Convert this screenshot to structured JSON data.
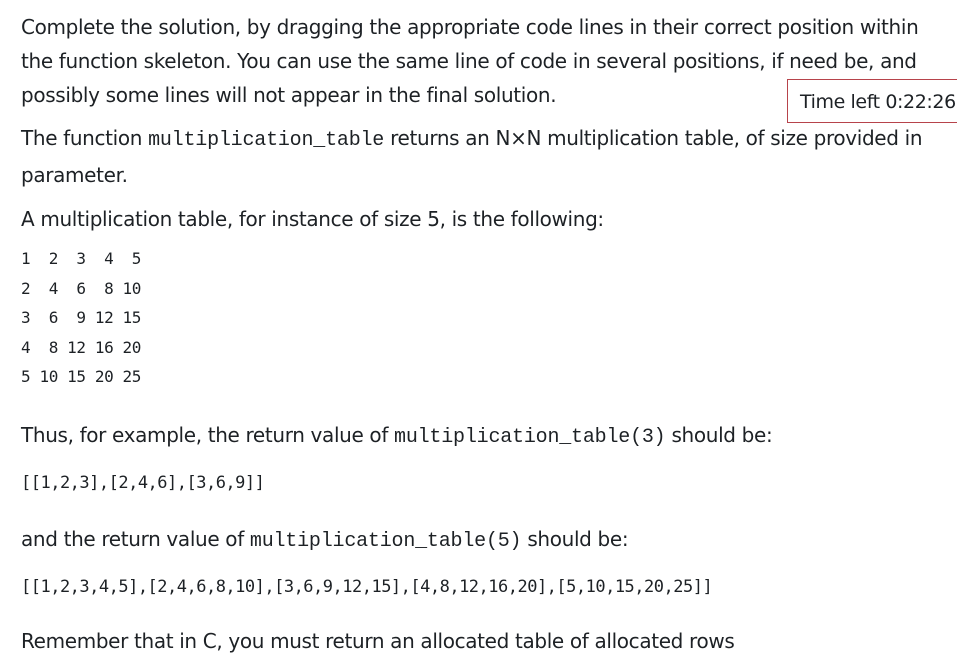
{
  "instructions": "Complete the solution, by dragging the appropriate code lines in their correct position within the function skeleton. You can use the same line of code in several positions, if need be, and possibly some lines will not appear in the final solution.",
  "timer": {
    "text": "Time left 0:22:26"
  },
  "description": {
    "part1": "The function ",
    "function_name": "multiplication_table",
    "part2": " returns an N×N multiplication table, of size provided in parameter."
  },
  "example_intro": "A multiplication table, for instance of size 5, is the following:",
  "table_rows": [
    "1  2  3  4  5",
    "2  4  6  8 10",
    "3  6  9 12 15",
    "4  8 12 16 20",
    "5 10 15 20 25"
  ],
  "example1": {
    "prefix": "Thus, for example, the return value of ",
    "call": "multiplication_table(3)",
    "suffix": " should be:",
    "result": "[[1,2,3],[2,4,6],[3,6,9]]"
  },
  "example2": {
    "prefix": "and the return value of ",
    "call": "multiplication_table(5)",
    "suffix": " should be:",
    "result": "[[1,2,3,4,5],[2,4,6,8,10],[3,6,9,12,15],[4,8,12,16,20],[5,10,15,20,25]]"
  },
  "reminder": "Remember that in C, you must return an allocated table of allocated rows"
}
